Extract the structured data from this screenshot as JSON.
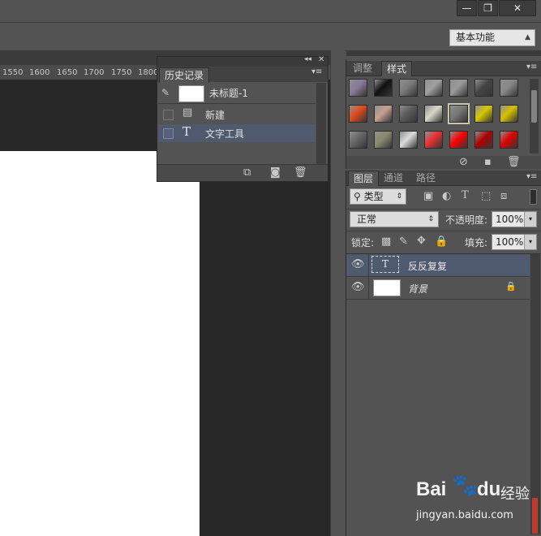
{
  "window": {
    "minimize_label": "—",
    "restore_label": "❐",
    "close_label": "✕"
  },
  "workspace": {
    "selected": "基本功能"
  },
  "ruler": {
    "ticks": [
      "1550",
      "1600",
      "1650",
      "1700",
      "1750",
      "1800"
    ]
  },
  "history": {
    "tab_label": "历史记录",
    "snapshot_label": "未标题-1",
    "items": [
      {
        "label": "新建",
        "icon": "new-document-icon"
      },
      {
        "label": "文字工具",
        "icon": "type-tool-icon"
      }
    ]
  },
  "styles_panel": {
    "tabs": [
      "调整",
      "样式"
    ],
    "active_tab": "样式",
    "swatch_colors": [
      "#8a7a9a",
      "#111111",
      "#7a7a7a",
      "#a0a0a0",
      "#9a9a9a",
      "#444444",
      "#888888",
      "#e04a1a",
      "#c9a090",
      "#5a5a5a",
      "#d8d8c8",
      "#777777",
      "#d6c800",
      "#d8c000",
      "#666666",
      "#8a8a70",
      "#dcdcdc",
      "#e83030",
      "#ff0000",
      "#b00000",
      "#e00000"
    ]
  },
  "layers_panel": {
    "tabs": [
      "图层",
      "通道",
      "路径"
    ],
    "active_tab": "图层",
    "filter_label": "类型",
    "blend_mode": "正常",
    "opacity_label": "不透明度:",
    "opacity_value": "100%",
    "lock_label": "锁定:",
    "fill_label": "填充:",
    "fill_value": "100%",
    "layers": [
      {
        "name": "反反复复",
        "type": "text",
        "selected": true
      },
      {
        "name": "背景",
        "type": "background",
        "selected": false,
        "locked": true
      }
    ]
  },
  "watermark": {
    "brand": "Bai",
    "brand_suffix": "du",
    "brand_cn": "经验",
    "url": "jingyan.baidu.com"
  },
  "colors": {
    "accent_selected": "#4f5a6e",
    "canvas_bg": "#282828"
  }
}
